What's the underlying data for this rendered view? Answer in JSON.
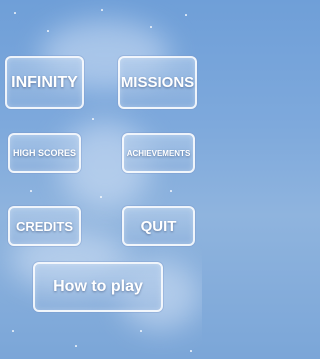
{
  "menu": {
    "infinity": "INFINITY",
    "missions": "MISSIONS",
    "high_scores": "HIGH SCORES",
    "achievements": "ACHIEVEMENTS",
    "credits": "CREDITS",
    "quit": "QUIT",
    "how_to_play": "How to play"
  },
  "colors": {
    "background": "#7ea9dc",
    "button_border": "#ffffff",
    "button_text": "#ffffff"
  }
}
